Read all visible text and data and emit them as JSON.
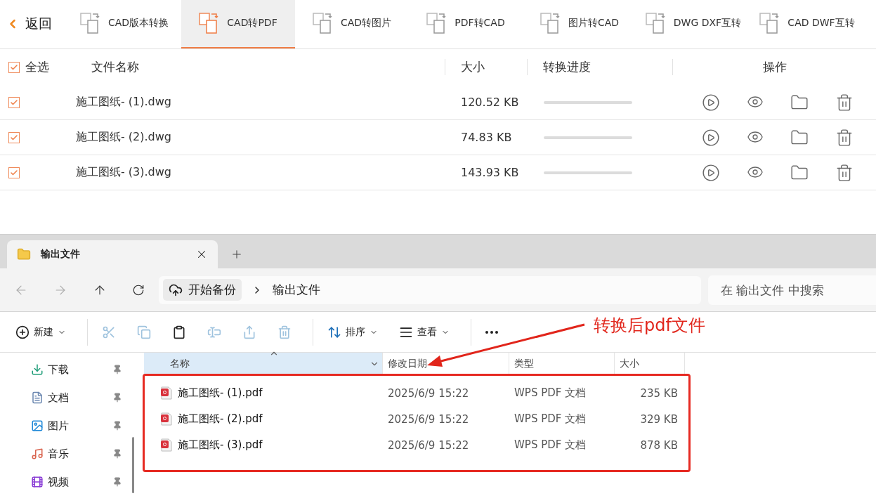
{
  "app": {
    "back": "返回",
    "tools": [
      {
        "label": "CAD版本转换",
        "selected": false
      },
      {
        "label": "CAD转PDF",
        "selected": true
      },
      {
        "label": "CAD转图片",
        "selected": false
      },
      {
        "label": "PDF转CAD",
        "selected": false
      },
      {
        "label": "图片转CAD",
        "selected": false
      },
      {
        "label": "DWG DXF互转",
        "selected": false
      },
      {
        "label": "CAD DWF互转",
        "selected": false
      }
    ],
    "select_all": {
      "label": "全选",
      "checked": true
    },
    "columns": [
      "文件名称",
      "大小",
      "转换进度",
      "操作"
    ],
    "rows": [
      {
        "name": "施工图纸- (1).dwg",
        "size": "120.52 KB",
        "checked": true,
        "level": 0
      },
      {
        "name": "施工图纸- (2).dwg",
        "size": "74.83 KB",
        "checked": true,
        "level": 0
      },
      {
        "name": "施工图纸- (3).dwg",
        "size": "143.93 KB",
        "checked": true,
        "level": 0
      }
    ]
  },
  "explorer": {
    "tab": {
      "title": "输出文件"
    },
    "breadcrumb": [
      "开始备份",
      "输出文件"
    ],
    "search": {
      "placeholder": "在 输出文件 中搜索"
    },
    "commands": [
      {
        "kind": "new",
        "label": "新建",
        "disabled": false
      },
      {
        "kind": "cut",
        "disabled": true
      },
      {
        "kind": "copy",
        "disabled": true
      },
      {
        "kind": "paste",
        "disabled": false
      },
      {
        "kind": "rename",
        "disabled": true
      },
      {
        "kind": "share",
        "disabled": true
      },
      {
        "kind": "delete",
        "disabled": true
      },
      {
        "kind": "sort",
        "label": "排序",
        "disabled": false
      },
      {
        "kind": "view",
        "label": "查看",
        "disabled": false
      },
      {
        "kind": "more",
        "disabled": false
      }
    ],
    "sidebar": [
      {
        "kind": "download",
        "label": "下载"
      },
      {
        "kind": "document",
        "label": "文档"
      },
      {
        "kind": "picture",
        "label": "图片"
      },
      {
        "kind": "music",
        "label": "音乐"
      },
      {
        "kind": "video",
        "label": "视频"
      }
    ],
    "columns": [
      "名称",
      "修改日期",
      "类型",
      "大小"
    ],
    "files": [
      {
        "name": "施工图纸- (1).pdf",
        "date": "2025/6/9 15:22",
        "type": "WPS PDF 文档",
        "size": "235 KB"
      },
      {
        "name": "施工图纸- (2).pdf",
        "date": "2025/6/9 15:22",
        "type": "WPS PDF 文档",
        "size": "329 KB"
      },
      {
        "name": "施工图纸- (3).pdf",
        "date": "2025/6/9 15:22",
        "type": "WPS PDF 文档",
        "size": "878 KB"
      }
    ]
  },
  "annotation": {
    "text": "转换后pdf文件"
  }
}
